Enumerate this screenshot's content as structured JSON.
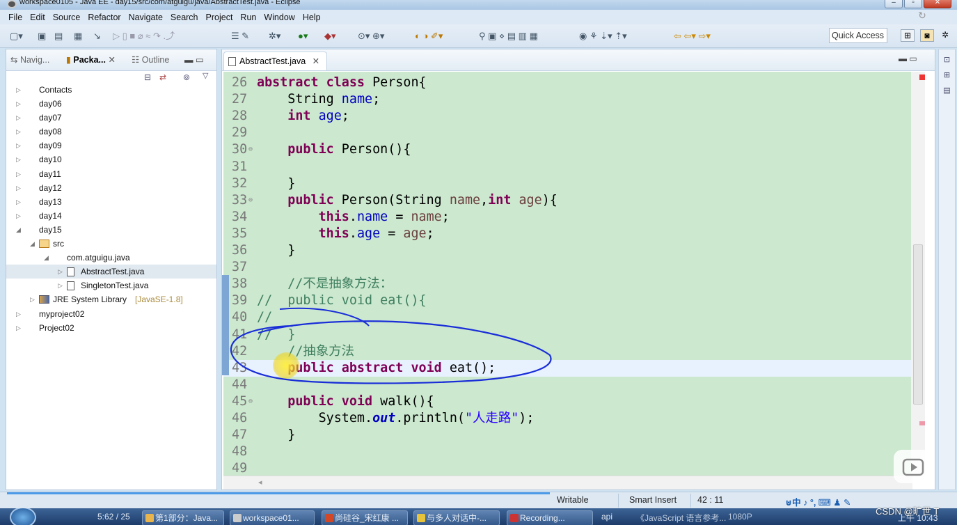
{
  "window": {
    "title": "workspace0105 - Java EE - day15/src/com/atguigu/java/AbstractTest.java - Eclipse",
    "buttons": [
      "–",
      "▫",
      "✕"
    ]
  },
  "menu": [
    "File",
    "Edit",
    "Source",
    "Refactor",
    "Navigate",
    "Search",
    "Project",
    "Run",
    "Window",
    "Help"
  ],
  "toolbar": {
    "quick_access_placeholder": "Quick Access",
    "icons": [
      "new-icon",
      "save-icon",
      "save-all-icon",
      "debug-icon",
      "run-icon",
      "coverage-icon",
      "search-icon",
      "back-icon",
      "forward-icon"
    ]
  },
  "left_panel": {
    "tabs": [
      {
        "label": "Navig...",
        "active": false
      },
      {
        "label": "Packa...",
        "active": true
      },
      {
        "label": "Outline",
        "active": false
      }
    ],
    "tree": [
      {
        "label": "Contacts",
        "type": "project",
        "depth": 0,
        "expanded": false
      },
      {
        "label": "day06",
        "type": "project",
        "depth": 0,
        "expanded": false
      },
      {
        "label": "day07",
        "type": "project",
        "depth": 0,
        "expanded": false
      },
      {
        "label": "day08",
        "type": "project",
        "depth": 0,
        "expanded": false
      },
      {
        "label": "day09",
        "type": "project",
        "depth": 0,
        "expanded": false
      },
      {
        "label": "day10",
        "type": "project",
        "depth": 0,
        "expanded": false
      },
      {
        "label": "day11",
        "type": "project",
        "depth": 0,
        "expanded": false
      },
      {
        "label": "day12",
        "type": "project",
        "depth": 0,
        "expanded": false
      },
      {
        "label": "day13",
        "type": "project",
        "depth": 0,
        "expanded": false
      },
      {
        "label": "day14",
        "type": "project",
        "depth": 0,
        "expanded": false
      },
      {
        "label": "day15",
        "type": "project",
        "depth": 0,
        "expanded": true
      },
      {
        "label": "src",
        "type": "src",
        "depth": 1,
        "expanded": true
      },
      {
        "label": "com.atguigu.java",
        "type": "package",
        "depth": 2,
        "expanded": true
      },
      {
        "label": "AbstractTest.java",
        "type": "java",
        "depth": 3,
        "expanded": false,
        "selected": true
      },
      {
        "label": "SingletonTest.java",
        "type": "java",
        "depth": 3,
        "expanded": false
      },
      {
        "label": "JRE System Library",
        "extra": "[JavaSE-1.8]",
        "type": "jre",
        "depth": 1,
        "expanded": false
      },
      {
        "label": "myproject02",
        "type": "project",
        "depth": 0,
        "expanded": false
      },
      {
        "label": "Project02",
        "type": "project",
        "depth": 0,
        "expanded": false
      }
    ]
  },
  "editor": {
    "tab_label": "AbstractTest.java",
    "lines": [
      {
        "n": "26",
        "tokens": [
          [
            "kw",
            "abstract class "
          ],
          [
            "",
            "Person{"
          ]
        ]
      },
      {
        "n": "27",
        "tokens": [
          [
            "",
            "    String "
          ],
          [
            "fld",
            "name"
          ],
          [
            "",
            ";"
          ]
        ]
      },
      {
        "n": "28",
        "tokens": [
          [
            "kw",
            "    int "
          ],
          [
            "fld",
            "age"
          ],
          [
            "",
            ";"
          ]
        ]
      },
      {
        "n": "29",
        "tokens": []
      },
      {
        "n": "30",
        "fold": true,
        "tokens": [
          [
            "kw",
            "    public "
          ],
          [
            "",
            "Person(){"
          ]
        ]
      },
      {
        "n": "31",
        "tokens": []
      },
      {
        "n": "32",
        "tokens": [
          [
            "",
            "    }"
          ]
        ]
      },
      {
        "n": "33",
        "fold": true,
        "tokens": [
          [
            "kw",
            "    public "
          ],
          [
            "",
            "Person(String "
          ],
          [
            "varp",
            "name"
          ],
          [
            "",
            ","
          ],
          [
            "kw",
            "int "
          ],
          [
            "varp",
            "age"
          ],
          [
            "",
            "){"
          ]
        ]
      },
      {
        "n": "34",
        "tokens": [
          [
            "kw",
            "        this"
          ],
          [
            "",
            "."
          ],
          [
            "fld",
            "name"
          ],
          [
            "",
            " = "
          ],
          [
            "varp",
            "name"
          ],
          [
            "",
            ";"
          ]
        ]
      },
      {
        "n": "35",
        "tokens": [
          [
            "kw",
            "        this"
          ],
          [
            "",
            "."
          ],
          [
            "fld",
            "age"
          ],
          [
            "",
            " = "
          ],
          [
            "varp",
            "age"
          ],
          [
            "",
            ";"
          ]
        ]
      },
      {
        "n": "36",
        "tokens": [
          [
            "",
            "    }"
          ]
        ]
      },
      {
        "n": "37",
        "tokens": []
      },
      {
        "n": "38",
        "tokens": [
          [
            "cmt",
            "    //不是抽象方法："
          ]
        ]
      },
      {
        "n": "39",
        "tokens": [
          [
            "cmt",
            "//  public void eat(){"
          ]
        ]
      },
      {
        "n": "40",
        "tokens": [
          [
            "cmt",
            "//"
          ]
        ]
      },
      {
        "n": "41",
        "tokens": [
          [
            "cmt",
            "//  }"
          ]
        ]
      },
      {
        "n": "42",
        "tokens": [
          [
            "cmt",
            "    //抽象方法"
          ]
        ]
      },
      {
        "n": "43",
        "current": true,
        "tokens": [
          [
            "kw",
            "    public abstract void "
          ],
          [
            "",
            "eat();"
          ]
        ]
      },
      {
        "n": "44",
        "tokens": []
      },
      {
        "n": "45",
        "fold": true,
        "tokens": [
          [
            "kw",
            "    public void "
          ],
          [
            "",
            "walk(){"
          ]
        ]
      },
      {
        "n": "46",
        "tokens": [
          [
            "",
            "        System."
          ],
          [
            "ital",
            "out"
          ],
          [
            "",
            ".println("
          ],
          [
            "str",
            "\"人走路\""
          ],
          [
            "",
            ");"
          ]
        ]
      },
      {
        "n": "47",
        "tokens": [
          [
            "",
            "    }"
          ]
        ]
      },
      {
        "n": "48",
        "tokens": []
      },
      {
        "n": "49",
        "tokens": []
      }
    ]
  },
  "status": {
    "writable": "Writable",
    "insert_mode": "Smart Insert",
    "position": "42 : 11"
  },
  "taskbar": {
    "items": [
      "第1部分：Java...",
      "workspace01...",
      "尚硅谷_宋红康 ...",
      "与多人对话中-...",
      "Recording...",
      "《JavaScript 语言参考..."
    ],
    "tray_left": "5:62 / 25",
    "tray_api": "api",
    "tray_quality": "1080P",
    "tray_time": "上午 10:43"
  },
  "watermark": "CSDN @旷世 T",
  "colors": {
    "editor_bg": "#cce8cf",
    "keyword": "#7f0055",
    "field": "#0000c0",
    "comment": "#3f7f5f",
    "string": "#2a00ff",
    "annotation_ink": "#1a2ed8",
    "cursor_highlight": "#f5e02a"
  }
}
